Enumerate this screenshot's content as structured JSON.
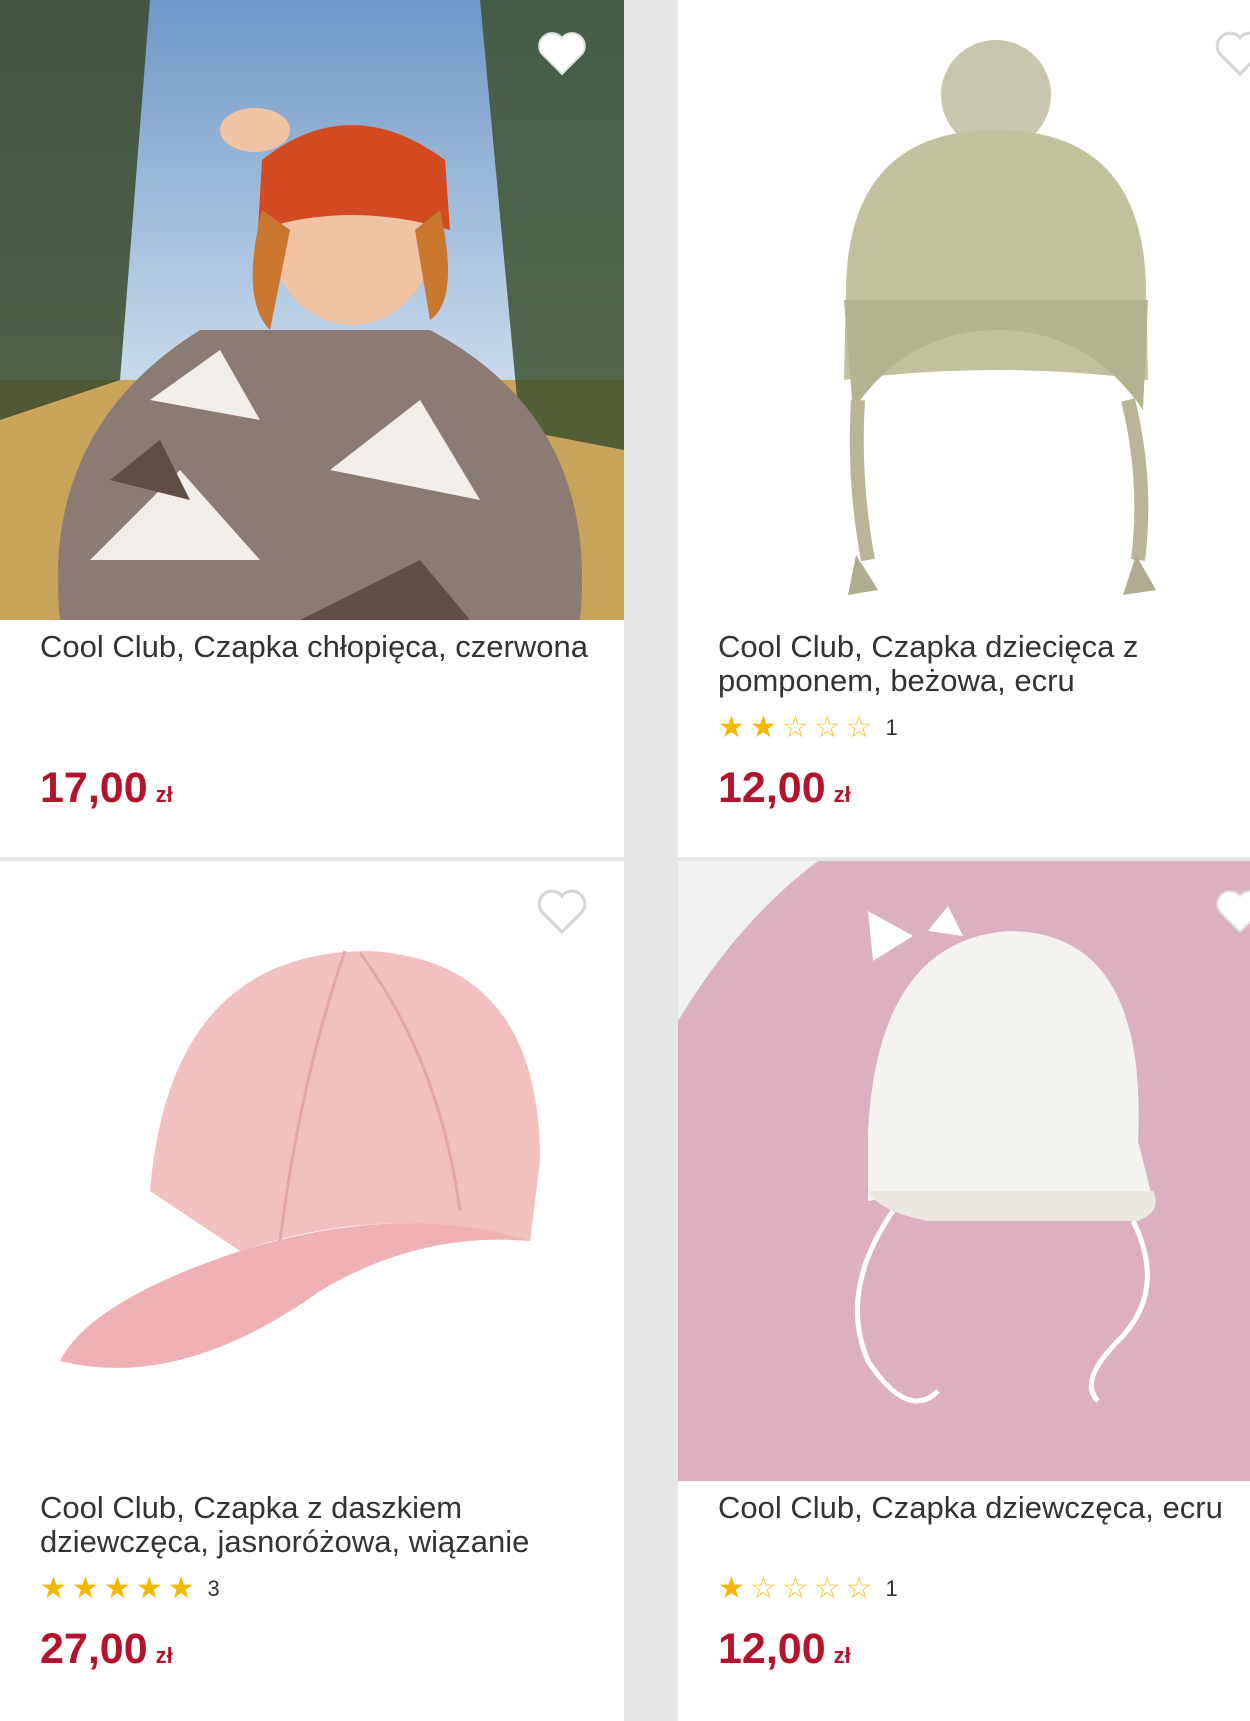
{
  "colors": {
    "price": "#b3132b",
    "star": "#f5b800",
    "background": "#e6e6e6",
    "card": "#ffffff"
  },
  "products": [
    {
      "title": "Cool Club, Czapka chłopięca, czerwona",
      "rating": null,
      "price": "17,00",
      "currency": "zł",
      "image_icon": "boy-in-red-beanie-photo"
    },
    {
      "title": "Cool Club, Czapka dziecięca z pomponem, beżowa, ecru",
      "rating": {
        "stars": 2,
        "max": 5,
        "count": "1"
      },
      "price": "12,00",
      "currency": "zł",
      "image_icon": "beige-pompom-hat-photo"
    },
    {
      "title": "Cool Club, Czapka z daszkiem dziewczęca, jasnoróżowa, wiązanie",
      "rating": {
        "stars": 5,
        "max": 5,
        "count": "3"
      },
      "price": "27,00",
      "currency": "zł",
      "image_icon": "pink-cap-photo"
    },
    {
      "title": "Cool Club, Czapka dziewczęca, ecru",
      "rating": {
        "stars": 1,
        "max": 5,
        "count": "1"
      },
      "price": "12,00",
      "currency": "zł",
      "image_icon": "white-baby-bonnet-photo"
    }
  ]
}
